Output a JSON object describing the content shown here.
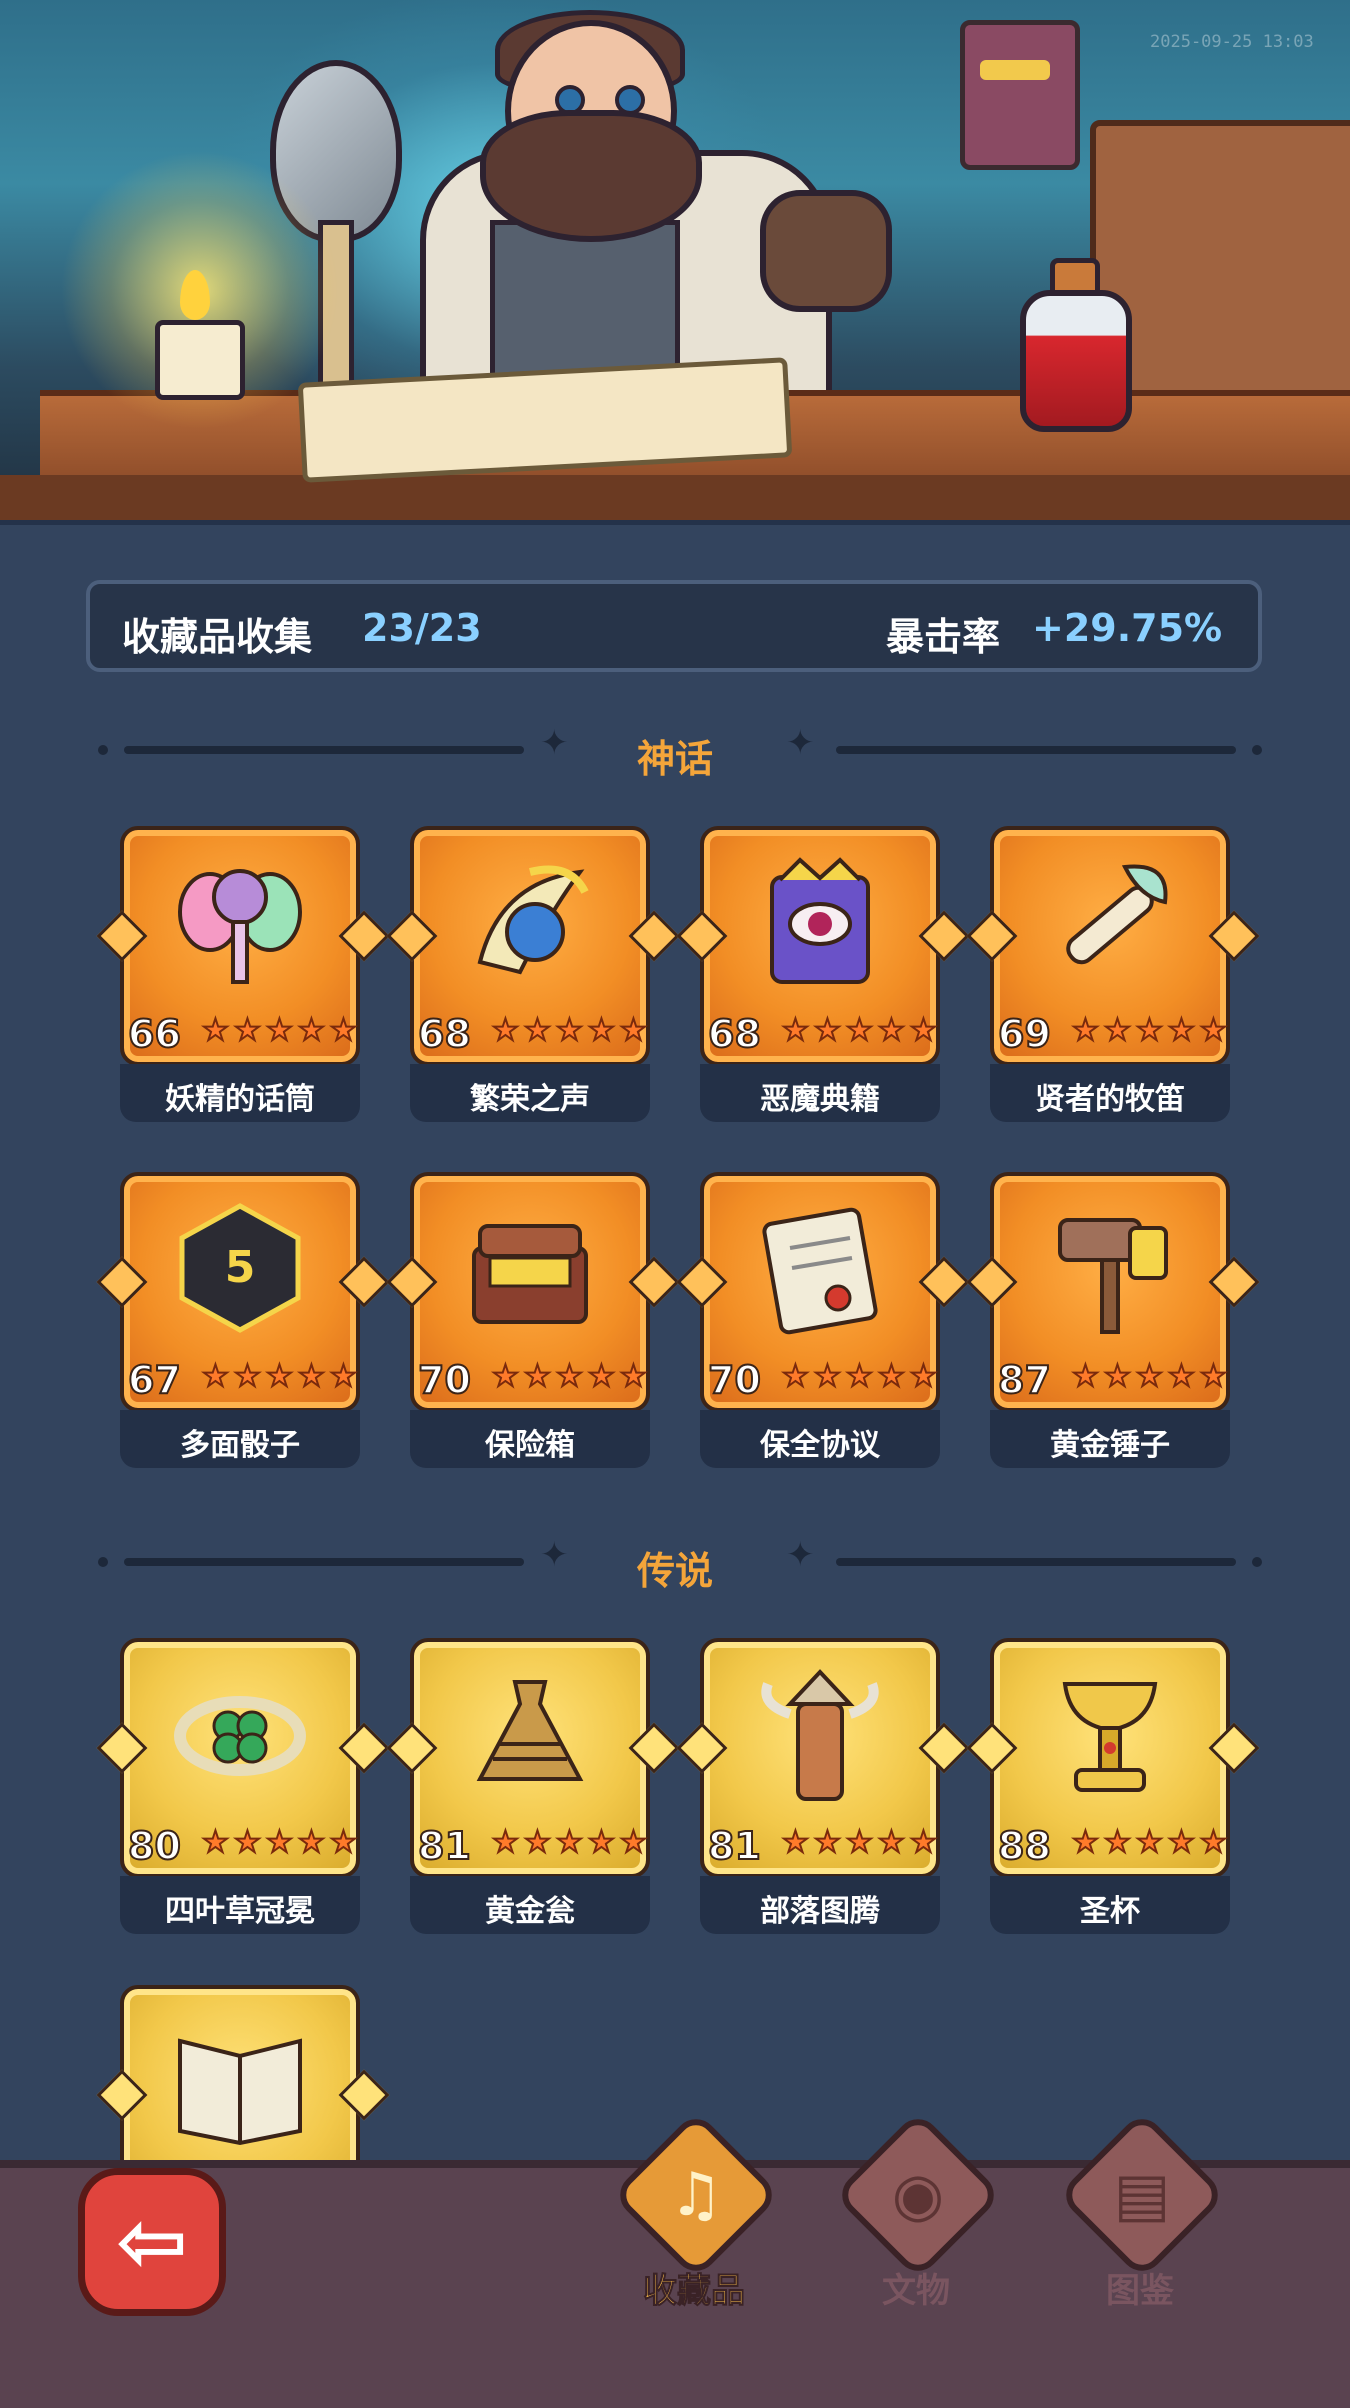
{
  "watermark": "2025-09-25 13:03",
  "stats": {
    "title": "收藏品收集",
    "count": "23/23",
    "crit_label": "暴击率",
    "crit_value": "+29.75%"
  },
  "sections": {
    "mythic": "神话",
    "legend": "传说"
  },
  "mythic_items": [
    {
      "name": "妖精的话筒",
      "level": "66",
      "stars": 5,
      "icon": "fairy-microphone-icon"
    },
    {
      "name": "繁荣之声",
      "level": "68",
      "stars": 5,
      "icon": "prosperity-horn-icon"
    },
    {
      "name": "恶魔典籍",
      "level": "68",
      "stars": 5,
      "icon": "demon-tome-icon"
    },
    {
      "name": "贤者的牧笛",
      "level": "69",
      "stars": 5,
      "icon": "sage-flute-icon"
    },
    {
      "name": "多面骰子",
      "level": "67",
      "stars": 5,
      "icon": "polyhedral-dice-icon"
    },
    {
      "name": "保险箱",
      "level": "70",
      "stars": 5,
      "icon": "treasure-chest-icon"
    },
    {
      "name": "保全协议",
      "level": "70",
      "stars": 5,
      "icon": "contract-scroll-icon"
    },
    {
      "name": "黄金锤子",
      "level": "87",
      "stars": 5,
      "icon": "golden-hammer-icon"
    }
  ],
  "legend_items": [
    {
      "name": "四叶草冠冕",
      "level": "80",
      "stars": 5,
      "icon": "clover-crown-icon"
    },
    {
      "name": "黄金瓮",
      "level": "81",
      "stars": 5,
      "icon": "golden-urn-icon"
    },
    {
      "name": "部落图腾",
      "level": "81",
      "stars": 5,
      "icon": "tribal-totem-icon"
    },
    {
      "name": "圣杯",
      "level": "88",
      "stars": 5,
      "icon": "holy-grail-icon"
    },
    {
      "name": "",
      "level": "",
      "stars": 0,
      "icon": "spellbook-icon"
    }
  ],
  "nav": {
    "collect": "收藏品",
    "relic": "文物",
    "codex": "图鉴"
  },
  "colors": {
    "mythic": "#f28e25",
    "legend": "#f2c84a",
    "accent_value": "#8ad0ff",
    "section_title": "#f4a53a",
    "background": "#33445e"
  }
}
